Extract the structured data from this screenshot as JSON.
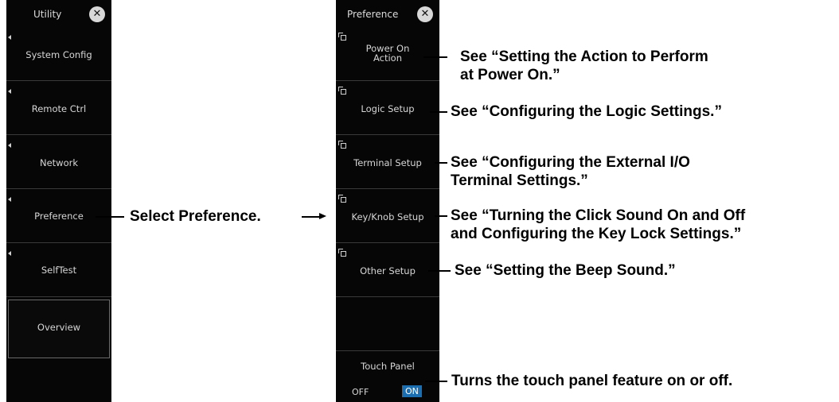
{
  "utility_panel": {
    "title": "Utility",
    "items": [
      {
        "label": "System Config"
      },
      {
        "label": "Remote Ctrl"
      },
      {
        "label": "Network"
      },
      {
        "label": "Preference"
      },
      {
        "label": "SelfTest"
      }
    ],
    "overview_label": "Overview"
  },
  "preference_panel": {
    "title": "Preference",
    "items": [
      {
        "label_line1": "Power On",
        "label_line2": "Action"
      },
      {
        "label": "Logic Setup"
      },
      {
        "label": "Terminal Setup"
      },
      {
        "label": "Key/Knob Setup"
      },
      {
        "label": "Other Setup"
      }
    ],
    "touch_panel": {
      "label": "Touch Panel",
      "off_label": "OFF",
      "on_label": "ON",
      "state": "ON"
    }
  },
  "annotations": {
    "select_preference": "Select Preference.",
    "power_on_line1": "See “Setting the Action to Perform",
    "power_on_line2": "at Power On.”",
    "logic": "See “Configuring the Logic Settings.”",
    "terminal_line1": "See “Configuring the External I/O",
    "terminal_line2": "Terminal Settings.”",
    "keyknob_line1": "See “Turning the Click Sound On and Off",
    "keyknob_line2": "and Configuring the Key Lock Settings.”",
    "other": "See “Setting the Beep Sound.”",
    "touch": "Turns the touch panel feature on or off."
  },
  "colors": {
    "panel_bg": "#060606",
    "on_highlight": "#1b6fb0"
  }
}
